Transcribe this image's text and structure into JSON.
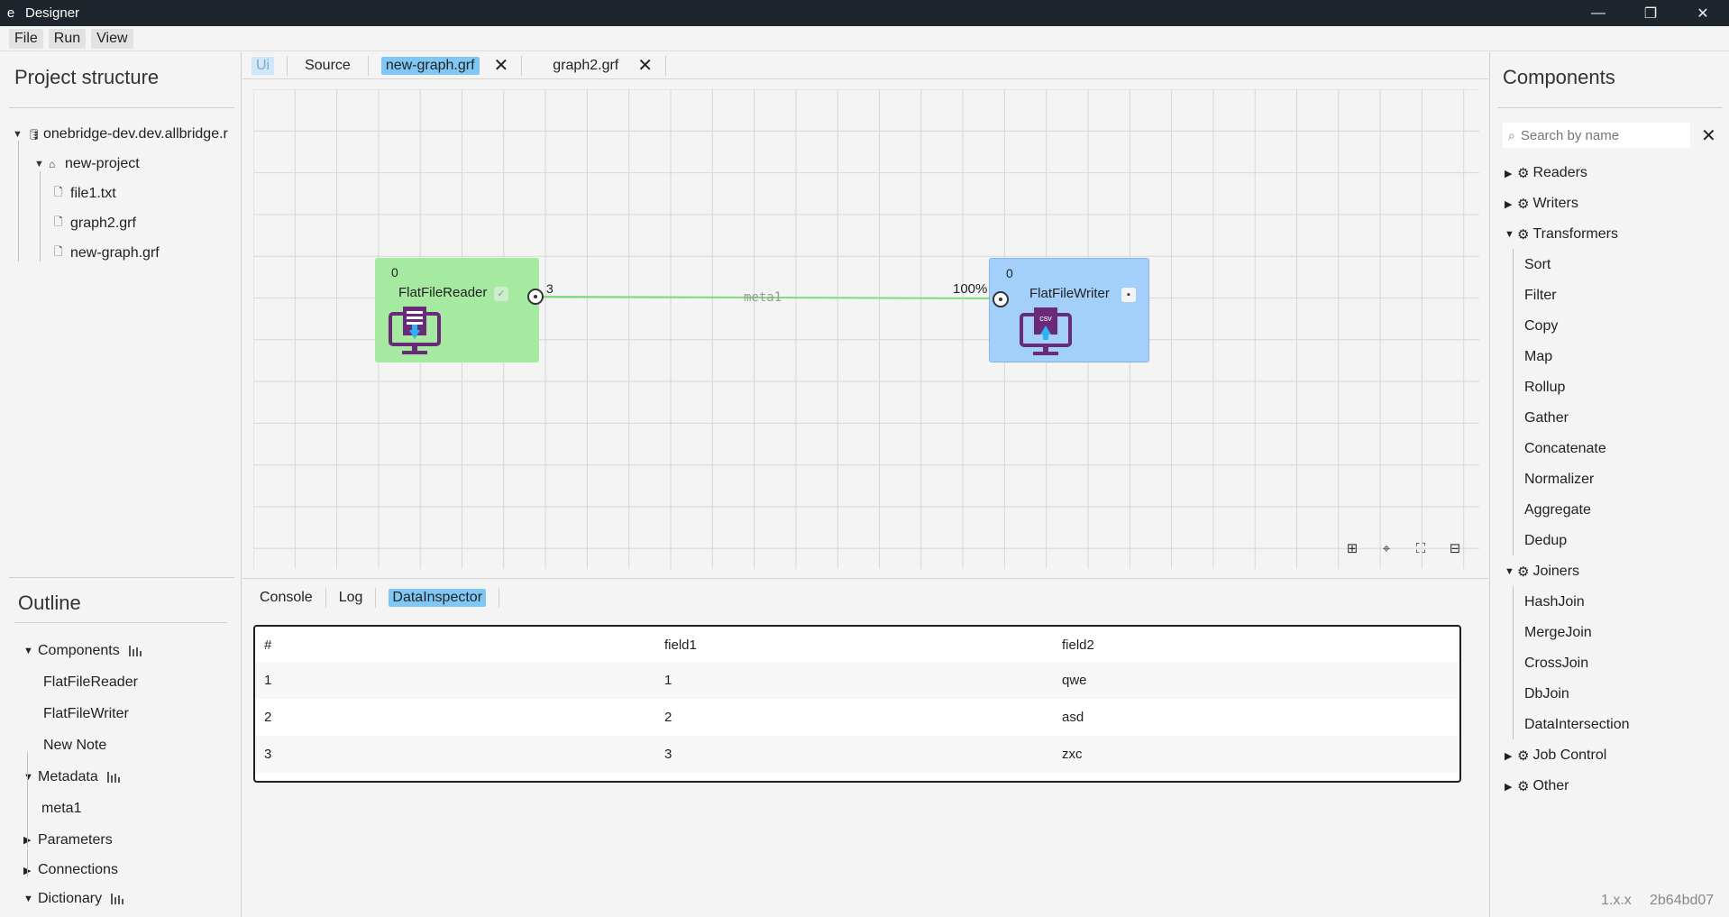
{
  "window": {
    "icon": "e",
    "title": "Designer",
    "minimize": "—",
    "restore": "❐",
    "close": "✕"
  },
  "menu": [
    "File",
    "Run",
    "View"
  ],
  "project": {
    "title": "Project structure",
    "root": "onebridge-dev.dev.allbridge.r",
    "project": "new-project",
    "files": [
      "file1.txt",
      "graph2.grf",
      "new-graph.grf"
    ]
  },
  "outline": {
    "title": "Outline",
    "sections": {
      "components": "Components",
      "component_items": [
        "FlatFileReader",
        "FlatFileWriter",
        "New Note"
      ],
      "metadata": "Metadata",
      "metadata_items": [
        "meta1"
      ],
      "parameters": "Parameters",
      "connections": "Connections",
      "dictionary": "Dictionary"
    }
  },
  "editor": {
    "tabs": [
      {
        "label": "Ui"
      },
      {
        "label": "Source"
      },
      {
        "label": "new-graph.grf",
        "close": "✕"
      },
      {
        "label": "graph2.grf",
        "close": "✕"
      }
    ],
    "reader": {
      "count": "0",
      "name": "FlatFileReader",
      "status": "✓",
      "port_count": "3"
    },
    "writer": {
      "count": "0",
      "name": "FlatFileWriter",
      "status": "▪",
      "progress": "100%",
      "file_type": "csv"
    },
    "edge_label": "meta1",
    "colors": {
      "reader_bg": "#a6e9a0",
      "writer_bg": "#a3cffb",
      "edge": "#7edc79",
      "icon": "#6a2a7a"
    }
  },
  "console": {
    "tabs": [
      "Console",
      "Log",
      "DataInspector"
    ],
    "table": {
      "columns": [
        "#",
        "field1",
        "field2"
      ],
      "rows": [
        [
          "1",
          "1",
          "qwe"
        ],
        [
          "2",
          "2",
          "asd"
        ],
        [
          "3",
          "3",
          "zxc"
        ]
      ]
    }
  },
  "components": {
    "title": "Components",
    "search_placeholder": "Search by name",
    "clear": "✕",
    "readers": "Readers",
    "writers": "Writers",
    "transformers": "Transformers",
    "transformer_items": [
      "Sort",
      "Filter",
      "Copy",
      "Map",
      "Rollup",
      "Gather",
      "Concatenate",
      "Normalizer",
      "Aggregate",
      "Dedup"
    ],
    "joiners": "Joiners",
    "joiner_items": [
      "HashJoin",
      "MergeJoin",
      "CrossJoin",
      "DbJoin",
      "DataIntersection"
    ],
    "job_control": "Job Control",
    "other": "Other"
  },
  "footer": {
    "version": "1.x.x",
    "build": "2b64bd07"
  }
}
